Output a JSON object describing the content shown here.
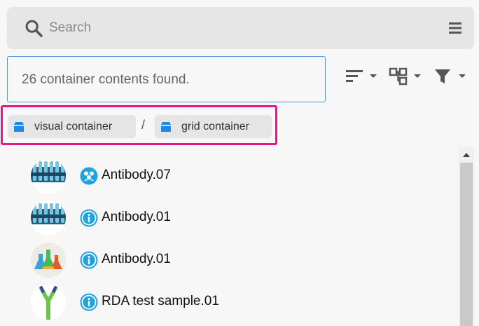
{
  "search": {
    "placeholder": "Search",
    "value": ""
  },
  "results": {
    "summary": "26 container contents found."
  },
  "toolbar": {
    "sort_icon": "sort-icon",
    "hierarchy_icon": "hierarchy-icon",
    "filter_icon": "filter-icon"
  },
  "breadcrumb": {
    "items": [
      {
        "label": "visual container",
        "icon": "container-icon"
      },
      {
        "label": "grid container",
        "icon": "container-icon"
      }
    ],
    "separator": "/"
  },
  "list": {
    "items": [
      {
        "label": "Antibody.07",
        "status_icon": "group-icon",
        "thumb": "vials"
      },
      {
        "label": "Antibody.01",
        "status_icon": "info-icon",
        "thumb": "vials"
      },
      {
        "label": "Antibody.01",
        "status_icon": "info-icon",
        "thumb": "flasks"
      },
      {
        "label": "RDA test sample.01",
        "status_icon": "info-icon",
        "thumb": "antibody"
      }
    ]
  },
  "colors": {
    "accent": "#1fa3e0",
    "highlight": "#e8168a",
    "chip_icon": "#1e88e5",
    "input_border": "#5a8fd6"
  }
}
